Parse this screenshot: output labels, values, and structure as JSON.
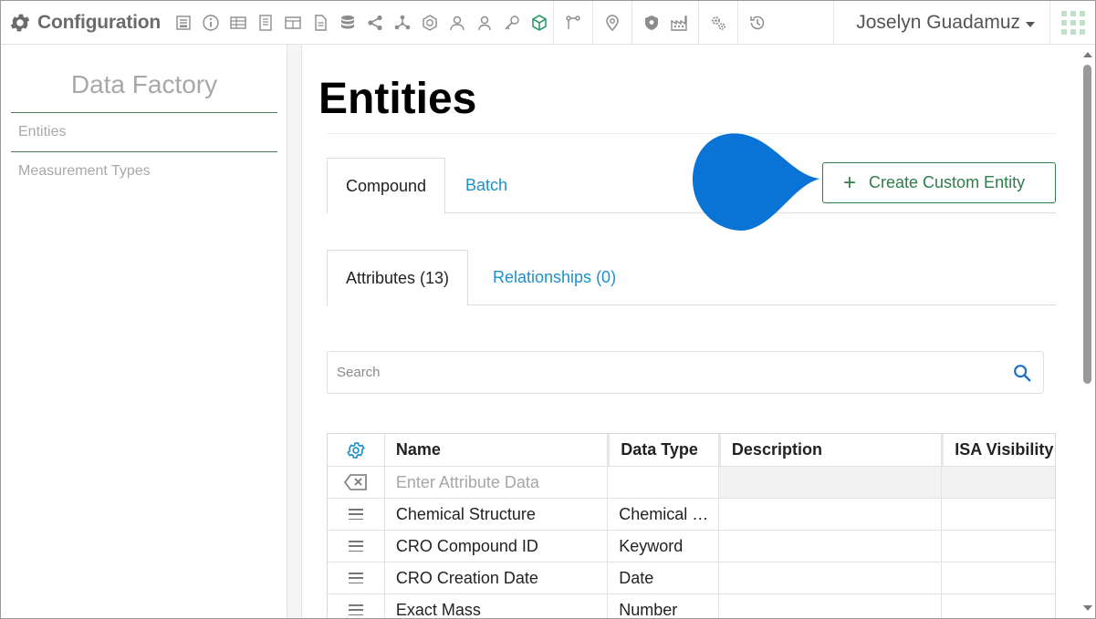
{
  "app": {
    "title": "Configuration",
    "user_name": "Joselyn Guadamuz"
  },
  "toolbar": {
    "icons": [
      "form-icon",
      "info-icon",
      "table-icon",
      "notebook-icon",
      "grid-table-icon",
      "document-icon",
      "database-icon",
      "share-icon",
      "network-icon",
      "badge-icon",
      "users-icon",
      "user-icon",
      "key-icon",
      "cube-icon",
      "workflow-icon",
      "location-pin-icon",
      "shield-icon",
      "factory-icon",
      "gears-icon",
      "history-icon",
      "apps-grid-icon"
    ]
  },
  "sidebar": {
    "title": "Data Factory",
    "items": [
      {
        "label": "Entities",
        "active": true
      },
      {
        "label": "Measurement Types",
        "active": false
      }
    ]
  },
  "main": {
    "page_title": "Entities",
    "entity_tabs": [
      {
        "label": "Compound",
        "active": true
      },
      {
        "label": "Batch",
        "active": false
      }
    ],
    "create_button_label": "Create Custom Entity",
    "sub_tabs": [
      {
        "label": "Attributes (13)",
        "active": true
      },
      {
        "label": "Relationships (0)",
        "active": false
      }
    ],
    "search": {
      "placeholder": "Search",
      "value": ""
    }
  },
  "grid": {
    "columns": [
      "Name",
      "Data Type",
      "Description",
      "ISA Visibility"
    ],
    "entry_placeholder": "Enter Attribute Data",
    "rows": [
      {
        "name": "Chemical Structure",
        "type": "Chemical Structure",
        "description": "",
        "visibility": ""
      },
      {
        "name": "CRO Compound ID",
        "type": "Keyword",
        "description": "",
        "visibility": ""
      },
      {
        "name": "CRO Creation Date",
        "type": "Date",
        "description": "",
        "visibility": ""
      },
      {
        "name": "Exact Mass",
        "type": "Number",
        "description": "",
        "visibility": ""
      }
    ]
  },
  "colors": {
    "accent_green": "#2e7d4a",
    "link_blue": "#1e90c8",
    "pointer_blue": "#0a74d6"
  }
}
